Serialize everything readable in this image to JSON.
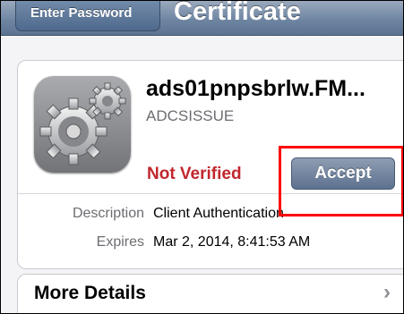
{
  "navbar": {
    "back_label": "Enter Password",
    "title": "Certificate",
    "color": "#6f86a3"
  },
  "certificate": {
    "icon": "gear-icon",
    "name": "ads01pnpsbrlw.FM...",
    "issuer": "ADCSISSUE",
    "status": "Not Verified",
    "status_color": "#c1272d",
    "accept_label": "Accept",
    "details": [
      {
        "label": "Description",
        "value": "Client Authentication"
      },
      {
        "label": "Expires",
        "value": "Mar 2, 2014, 8:41:53 AM"
      }
    ]
  },
  "more_details": {
    "label": "More Details",
    "icon": "chevron-right-icon"
  },
  "annotation_color": "#ff0000"
}
